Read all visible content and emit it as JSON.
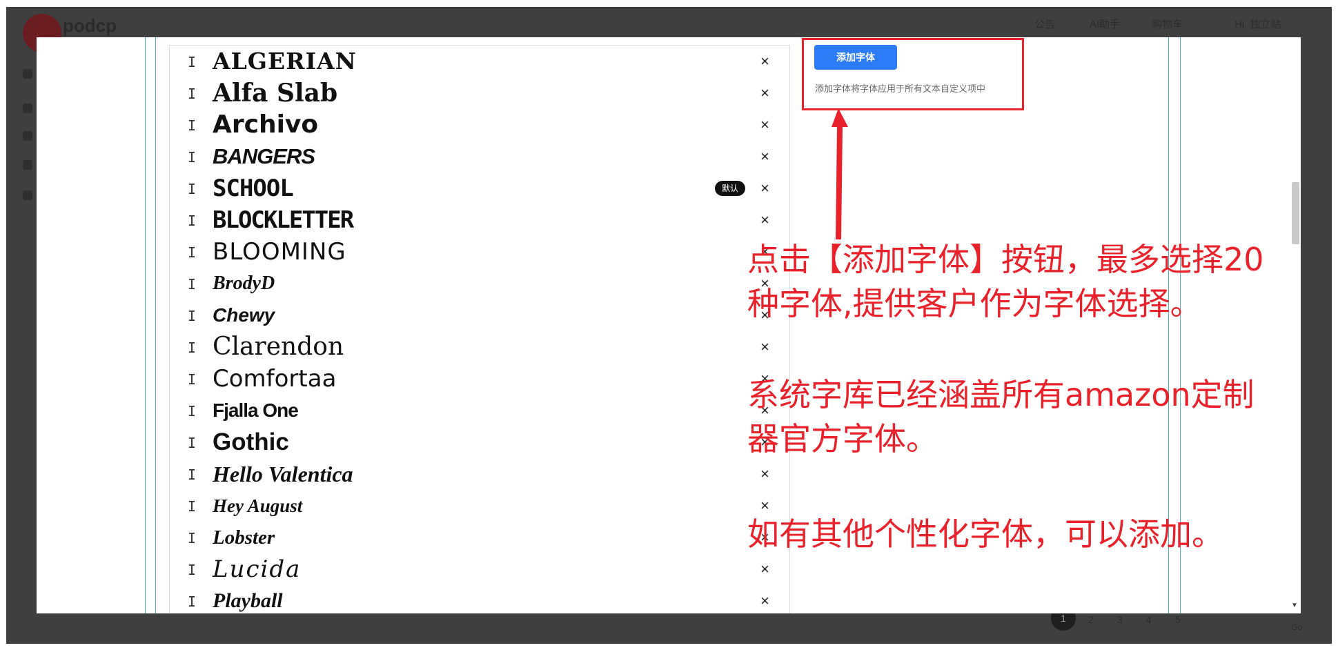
{
  "background": {
    "logo_text": "podcp",
    "nav": [
      "公告",
      "AI助手",
      "购物车",
      "Hi, 独立站"
    ],
    "pagination": [
      "1",
      "2",
      "3",
      "4",
      "5"
    ],
    "go_label": "Go"
  },
  "fonts": [
    {
      "name": "ALGERIAN",
      "default": false
    },
    {
      "name": "Alfa Slab",
      "default": false
    },
    {
      "name": "Archivo",
      "default": false
    },
    {
      "name": "BANGERS",
      "default": false
    },
    {
      "name": "SCHOOL",
      "default": true
    },
    {
      "name": "BLOCKLETTER",
      "default": false
    },
    {
      "name": "BLOOMING",
      "default": false
    },
    {
      "name": "BrodyD",
      "default": false
    },
    {
      "name": "Chewy",
      "default": false
    },
    {
      "name": "Clarendon",
      "default": false
    },
    {
      "name": "Comfortaa",
      "default": false
    },
    {
      "name": "Fjalla One",
      "default": false
    },
    {
      "name": "Gothic",
      "default": false
    },
    {
      "name": "Hello Valentica",
      "default": false
    },
    {
      "name": "Hey August",
      "default": false
    },
    {
      "name": "Lobster",
      "default": false
    },
    {
      "name": "Lucida",
      "default": false
    },
    {
      "name": "Playball",
      "default": false
    }
  ],
  "default_badge": "默认",
  "delete_glyph": "×",
  "ibeam_glyph": "I",
  "add_font": {
    "button_label": "添加字体",
    "hint": "添加字体将字体应用于所有文本自定义项中"
  },
  "annotations": {
    "line1": "点击【添加字体】按钮，最多选择20",
    "line2": "种字体,提供客户作为字体选择。",
    "line3": "系统字库已经涵盖所有amazon定制",
    "line4": "器官方字体。",
    "line5": "如有其他个性化字体，可以添加。"
  },
  "colors": {
    "annotation_red": "#e8212a",
    "button_blue": "#2b7cf6",
    "overlay": "#3f3f3f"
  }
}
